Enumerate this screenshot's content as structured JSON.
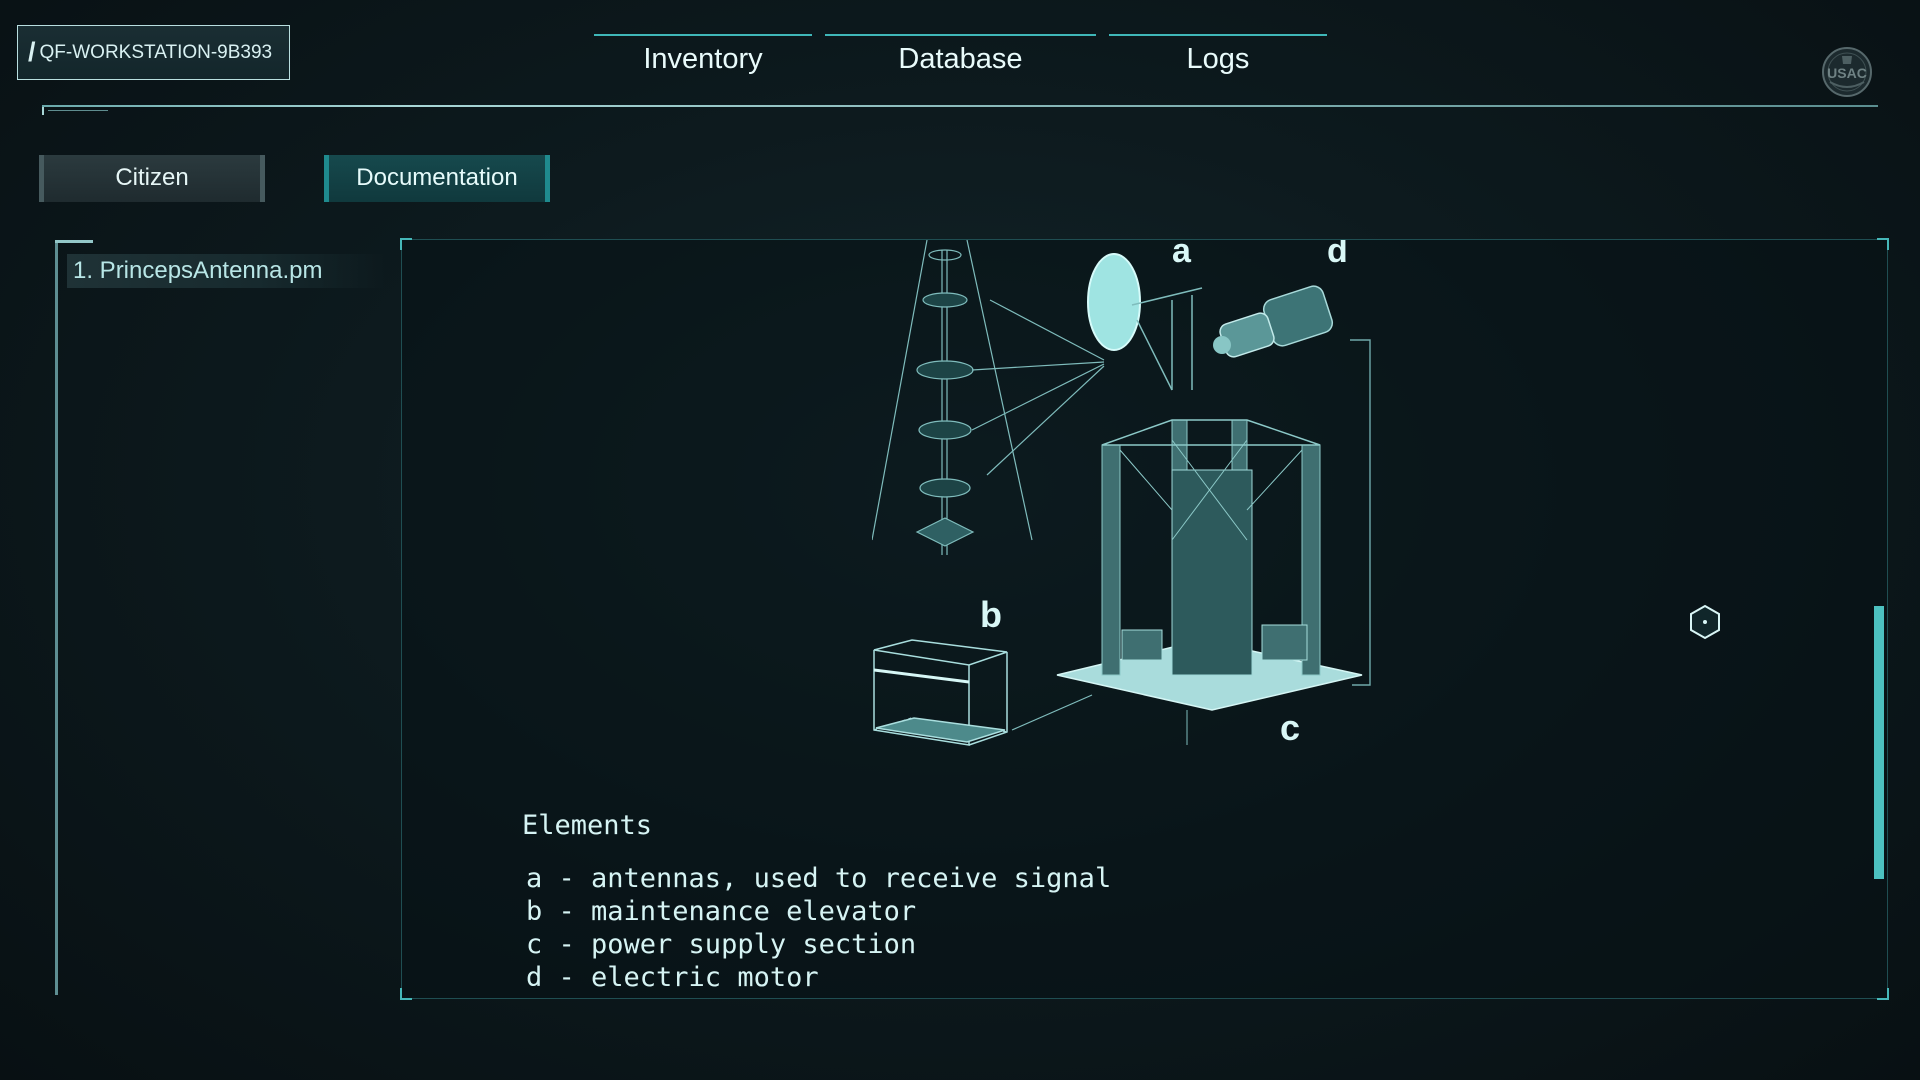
{
  "workstation": {
    "prefix": "/",
    "name": "QF-WORKSTATION-9B393"
  },
  "nav": {
    "inventory": "Inventory",
    "database": "Database",
    "logs": "Logs"
  },
  "logo": {
    "text": "USAC"
  },
  "subnav": {
    "citizen": "Citizen",
    "documentation": "Documentation",
    "active": "Documentation"
  },
  "files": [
    {
      "label": "1. PrincepsAntenna.pm"
    }
  ],
  "document": {
    "diagram_labels": {
      "a": "a",
      "b": "b",
      "c": "c",
      "d": "d"
    },
    "elements_title": "Elements",
    "elements": [
      "a - antennas, used to receive signal",
      "b - maintenance elevator",
      "c - power supply section",
      "d - electric motor"
    ]
  },
  "colors": {
    "accent": "#46b8b9",
    "background": "#0d1a1e",
    "text": "#d6f4f4"
  },
  "icons": {
    "cursor": "hexagon-cursor-icon",
    "logo": "usac-emblem-icon"
  }
}
